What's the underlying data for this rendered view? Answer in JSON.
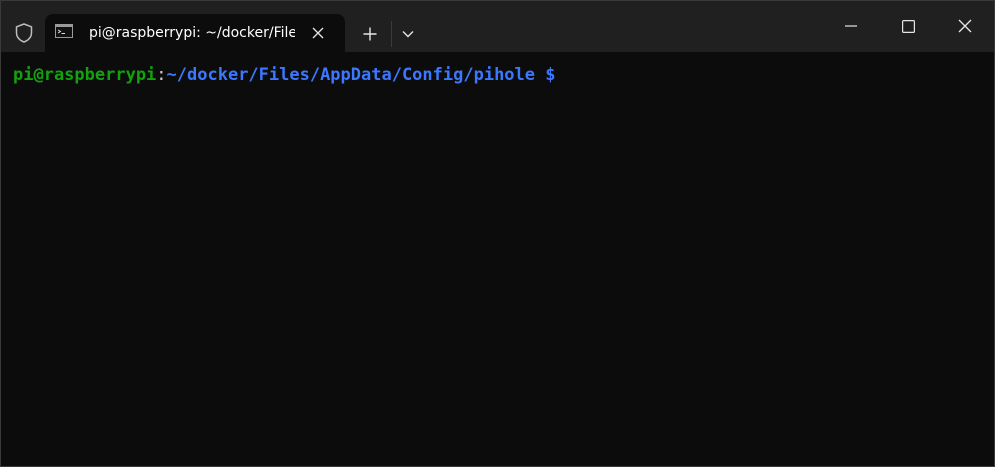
{
  "window": {
    "tab_title": "pi@raspberrypi: ~/docker/Files/AppData/Config/pihole",
    "icons": {
      "shield": "shield-icon",
      "terminal": "terminal-icon",
      "tab_close": "close-icon",
      "new_tab": "plus-icon",
      "dropdown": "chevron-down-icon",
      "minimize": "minimize-icon",
      "maximize": "maximize-icon",
      "close": "close-icon"
    }
  },
  "terminal": {
    "user_host": "pi@raspberrypi",
    "colon": ":",
    "path": "~/docker/Files/AppData/Config/pihole",
    "dollar": " $"
  },
  "colors": {
    "background": "#0c0c0c",
    "titlebar": "#202020",
    "prompt_user": "#13a10e",
    "prompt_path": "#3b78ff"
  }
}
